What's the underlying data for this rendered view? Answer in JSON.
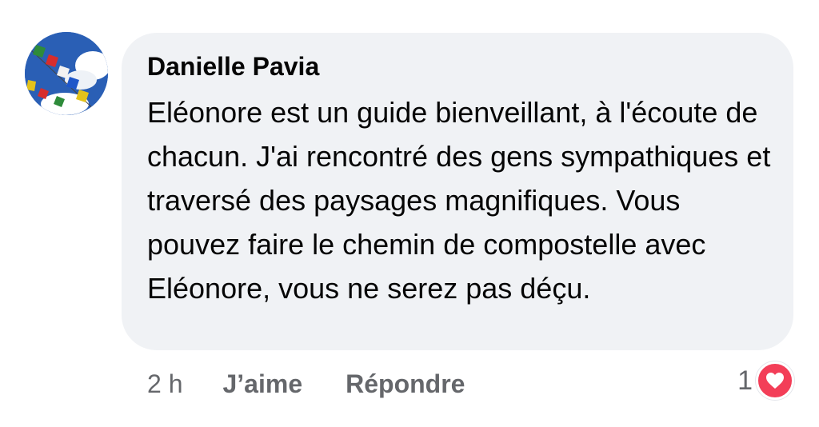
{
  "comment": {
    "author": "Danielle Pavia",
    "text": "Eléonore est un guide bienveillant, à l'écoute de chacun. J'ai rencontré des gens sympathiques et traversé des paysages magnifiques. Vous pouvez faire le chemin de compostelle avec Eléonore, vous ne serez pas déçu.",
    "avatar_icon": "prayer-flags-avatar"
  },
  "actions": {
    "time": "2 h",
    "like_label": "J’aime",
    "reply_label": "Répondre"
  },
  "reactions": {
    "count": "1",
    "icon": "heart-icon",
    "badge_color": "#f33e58"
  },
  "colors": {
    "bubble": "#f0f2f5",
    "text": "#050505",
    "secondary_text": "#65676b"
  }
}
